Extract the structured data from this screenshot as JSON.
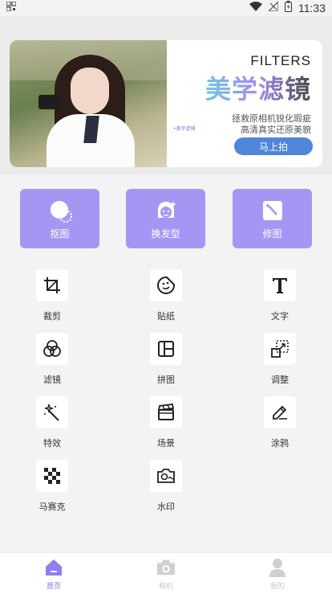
{
  "status_bar": {
    "time": "11:33"
  },
  "banner": {
    "filters_label": "FILTERS",
    "title": "美学滤镜",
    "small_tag": "•美学滤镜",
    "desc_line1": "拯救原相机锐化瑕疵",
    "desc_line2": "高清真实还原美貌",
    "cta_label": "马上拍"
  },
  "features": [
    {
      "label": "抠图",
      "icon": "cutout-icon"
    },
    {
      "label": "换发型",
      "icon": "hairstyle-icon"
    },
    {
      "label": "修图",
      "icon": "retouch-icon"
    }
  ],
  "tools": [
    {
      "label": "裁剪",
      "icon": "crop-icon"
    },
    {
      "label": "贴纸",
      "icon": "sticker-icon"
    },
    {
      "label": "文字",
      "icon": "text-icon"
    },
    {
      "label": "滤镜",
      "icon": "filter-icon"
    },
    {
      "label": "拼图",
      "icon": "collage-icon"
    },
    {
      "label": "调整",
      "icon": "adjust-icon"
    },
    {
      "label": "特效",
      "icon": "effects-icon"
    },
    {
      "label": "场景",
      "icon": "scene-icon"
    },
    {
      "label": "涂鸦",
      "icon": "doodle-icon"
    },
    {
      "label": "马赛克",
      "icon": "mosaic-icon"
    },
    {
      "label": "水印",
      "icon": "watermark-icon"
    }
  ],
  "bottom_nav": [
    {
      "label": "首页",
      "icon": "home-icon",
      "active": true
    },
    {
      "label": "相机",
      "icon": "camera-icon",
      "active": false
    },
    {
      "label": "我的",
      "icon": "profile-icon",
      "active": false
    }
  ],
  "colors": {
    "accent": "#a497f4",
    "nav_active": "#7d6ff0",
    "cta": "#4f86d9"
  }
}
